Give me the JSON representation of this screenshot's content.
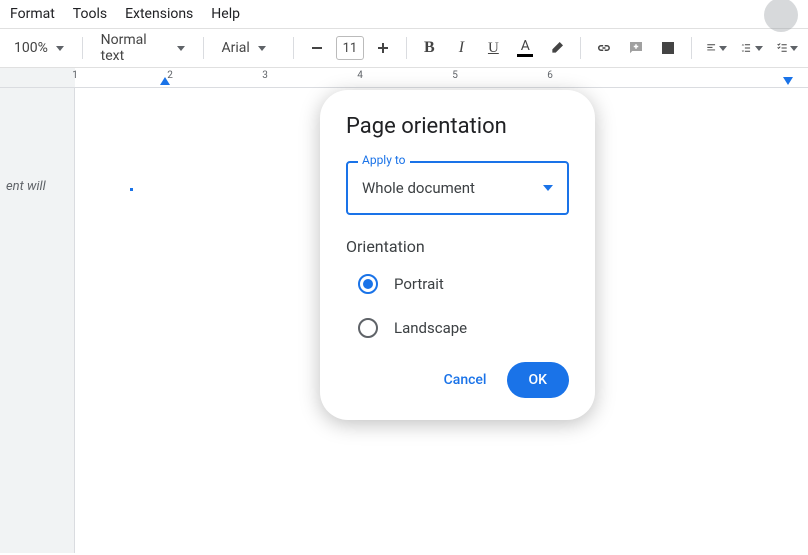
{
  "menubar": {
    "format": "Format",
    "tools": "Tools",
    "extensions": "Extensions",
    "help": "Help"
  },
  "toolbar": {
    "zoom": "100%",
    "styles": "Normal text",
    "font": "Arial",
    "font_size": "11"
  },
  "ruler": {
    "ticks": [
      "1",
      "2",
      "3",
      "4",
      "5",
      "6"
    ]
  },
  "outline": {
    "hint_line1": "ent will"
  },
  "dialog": {
    "title": "Page orientation",
    "apply_to_label": "Apply to",
    "apply_to_value": "Whole document",
    "orientation_label": "Orientation",
    "options": {
      "portrait": "Portrait",
      "landscape": "Landscape"
    },
    "selected": "portrait",
    "cancel": "Cancel",
    "ok": "OK"
  }
}
